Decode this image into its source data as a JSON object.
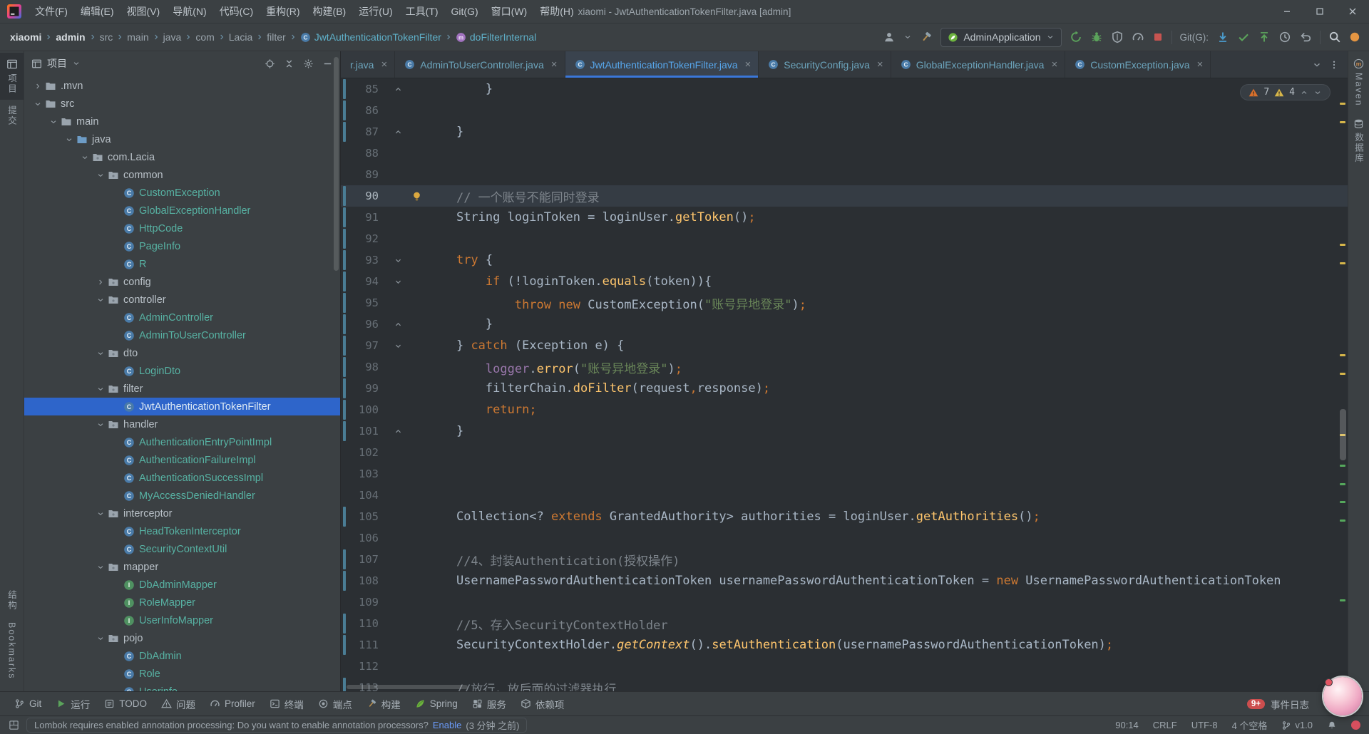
{
  "window": {
    "title": "xiaomi - JwtAuthenticationTokenFilter.java [admin]",
    "menu": [
      "文件(F)",
      "编辑(E)",
      "视图(V)",
      "导航(N)",
      "代码(C)",
      "重构(R)",
      "构建(B)",
      "运行(U)",
      "工具(T)",
      "Git(G)",
      "窗口(W)",
      "帮助(H)"
    ]
  },
  "navbar": {
    "path": [
      "xiaomi",
      "admin",
      "src",
      "main",
      "java",
      "com",
      "Lacia",
      "filter"
    ],
    "class_item": "JwtAuthenticationTokenFilter",
    "method_item": "doFilterInternal",
    "run_config": "AdminApplication",
    "git_label": "Git(G):"
  },
  "left_stripe": {
    "project": "项目",
    "commit": "提交",
    "structure": "结构",
    "bookmarks": "Bookmarks"
  },
  "right_stripe": {
    "maven": "Maven",
    "database": "数据库"
  },
  "project_panel": {
    "title": "项目",
    "tree": [
      {
        "l": ".mvn",
        "t": "folder",
        "c": "r",
        "i": 0
      },
      {
        "l": "src",
        "t": "folder",
        "c": "d",
        "i": 0
      },
      {
        "l": "main",
        "t": "folder",
        "c": "d",
        "i": 1
      },
      {
        "l": "java",
        "t": "src",
        "c": "d",
        "i": 2
      },
      {
        "l": "com.Lacia",
        "t": "pkg",
        "c": "d",
        "i": 3
      },
      {
        "l": "common",
        "t": "pkg",
        "c": "d",
        "i": 4
      },
      {
        "l": "CustomException",
        "t": "class",
        "c": "n",
        "i": 5
      },
      {
        "l": "GlobalExceptionHandler",
        "t": "class",
        "c": "n",
        "i": 5
      },
      {
        "l": "HttpCode",
        "t": "class",
        "c": "n",
        "i": 5
      },
      {
        "l": "PageInfo",
        "t": "class",
        "c": "n",
        "i": 5
      },
      {
        "l": "R",
        "t": "class",
        "c": "n",
        "i": 5
      },
      {
        "l": "config",
        "t": "pkg",
        "c": "r",
        "i": 4
      },
      {
        "l": "controller",
        "t": "pkg",
        "c": "d",
        "i": 4
      },
      {
        "l": "AdminController",
        "t": "class",
        "c": "n",
        "i": 5
      },
      {
        "l": "AdminToUserController",
        "t": "class",
        "c": "n",
        "i": 5
      },
      {
        "l": "dto",
        "t": "pkg",
        "c": "d",
        "i": 4
      },
      {
        "l": "LoginDto",
        "t": "class",
        "c": "n",
        "i": 5
      },
      {
        "l": "filter",
        "t": "pkg",
        "c": "d",
        "i": 4
      },
      {
        "l": "JwtAuthenticationTokenFilter",
        "t": "class",
        "c": "n",
        "i": 5,
        "sel": true
      },
      {
        "l": "handler",
        "t": "pkg",
        "c": "d",
        "i": 4
      },
      {
        "l": "AuthenticationEntryPointImpl",
        "t": "class",
        "c": "n",
        "i": 5
      },
      {
        "l": "AuthenticationFailureImpl",
        "t": "class",
        "c": "n",
        "i": 5
      },
      {
        "l": "AuthenticationSuccessImpl",
        "t": "class",
        "c": "n",
        "i": 5
      },
      {
        "l": "MyAccessDeniedHandler",
        "t": "class",
        "c": "n",
        "i": 5
      },
      {
        "l": "interceptor",
        "t": "pkg",
        "c": "d",
        "i": 4
      },
      {
        "l": "HeadTokenInterceptor",
        "t": "class",
        "c": "n",
        "i": 5
      },
      {
        "l": "SecurityContextUtil",
        "t": "class",
        "c": "n",
        "i": 5
      },
      {
        "l": "mapper",
        "t": "pkg",
        "c": "d",
        "i": 4
      },
      {
        "l": "DbAdminMapper",
        "t": "iface",
        "c": "n",
        "i": 5
      },
      {
        "l": "RoleMapper",
        "t": "iface",
        "c": "n",
        "i": 5
      },
      {
        "l": "UserInfoMapper",
        "t": "iface",
        "c": "n",
        "i": 5
      },
      {
        "l": "pojo",
        "t": "pkg",
        "c": "d",
        "i": 4
      },
      {
        "l": "DbAdmin",
        "t": "class",
        "c": "n",
        "i": 5
      },
      {
        "l": "Role",
        "t": "class",
        "c": "n",
        "i": 5
      },
      {
        "l": "Userinfo",
        "t": "class",
        "c": "n",
        "i": 5
      }
    ]
  },
  "tabs": [
    {
      "label": "r.java",
      "icon": false
    },
    {
      "label": "AdminToUserController.java",
      "icon": true
    },
    {
      "label": "JwtAuthenticationTokenFilter.java",
      "icon": true,
      "active": true
    },
    {
      "label": "SecurityConfig.java",
      "icon": true
    },
    {
      "label": "GlobalExceptionHandler.java",
      "icon": true
    },
    {
      "label": "CustomException.java",
      "icon": true
    }
  ],
  "inspections": {
    "warnings": "7",
    "weak_warnings": "4"
  },
  "editor": {
    "lines": [
      {
        "n": 85,
        "ind": 8,
        "chg": true,
        "fold": "up",
        "tok": [
          [
            "}",
            "d"
          ]
        ]
      },
      {
        "n": 86,
        "ind": 0,
        "chg": true,
        "tok": []
      },
      {
        "n": 87,
        "ind": 4,
        "chg": true,
        "fold": "up",
        "tok": [
          [
            "}",
            "d"
          ]
        ]
      },
      {
        "n": 88,
        "ind": 0,
        "tok": []
      },
      {
        "n": 89,
        "ind": 0,
        "tok": []
      },
      {
        "n": 90,
        "ind": 4,
        "chg": true,
        "cur": true,
        "bulb": true,
        "tok": [
          [
            "// 一个账号不能同时登录",
            "c"
          ]
        ]
      },
      {
        "n": 91,
        "ind": 4,
        "chg": true,
        "tok": [
          [
            "String loginToken = loginUser.",
            "d"
          ],
          [
            "getToken",
            "m"
          ],
          [
            "()",
            "d"
          ],
          [
            ";",
            "k"
          ]
        ]
      },
      {
        "n": 92,
        "ind": 0,
        "chg": true,
        "tok": []
      },
      {
        "n": 93,
        "ind": 4,
        "chg": true,
        "fold": "down",
        "tok": [
          [
            "try",
            "k"
          ],
          [
            " {",
            "d"
          ]
        ]
      },
      {
        "n": 94,
        "ind": 8,
        "chg": true,
        "fold": "down",
        "tok": [
          [
            "if",
            "k"
          ],
          [
            " (!loginToken.",
            "d"
          ],
          [
            "equals",
            "m"
          ],
          [
            "(token)){",
            "d"
          ]
        ]
      },
      {
        "n": 95,
        "ind": 12,
        "chg": true,
        "tok": [
          [
            "throw",
            "k"
          ],
          [
            " ",
            "d"
          ],
          [
            "new",
            "k"
          ],
          [
            " CustomException(",
            "d"
          ],
          [
            "\"账号异地登录\"",
            "s"
          ],
          [
            ")",
            "d"
          ],
          [
            ";",
            "k"
          ]
        ]
      },
      {
        "n": 96,
        "ind": 8,
        "chg": true,
        "fold": "up",
        "tok": [
          [
            "}",
            "d"
          ]
        ]
      },
      {
        "n": 97,
        "ind": 4,
        "chg": true,
        "fold": "down",
        "tok": [
          [
            "} ",
            "d"
          ],
          [
            "catch",
            "k"
          ],
          [
            " (Exception e) {",
            "d"
          ]
        ]
      },
      {
        "n": 98,
        "ind": 8,
        "chg": true,
        "tok": [
          [
            "logger",
            "f"
          ],
          [
            ".",
            "d"
          ],
          [
            "error",
            "m"
          ],
          [
            "(",
            "d"
          ],
          [
            "\"账号异地登录\"",
            "s"
          ],
          [
            ")",
            "d"
          ],
          [
            ";",
            "k"
          ]
        ]
      },
      {
        "n": 99,
        "ind": 8,
        "chg": true,
        "tok": [
          [
            "filterChain.",
            "d"
          ],
          [
            "doFilter",
            "m"
          ],
          [
            "(request",
            "d"
          ],
          [
            ",",
            "k"
          ],
          [
            "response)",
            "d"
          ],
          [
            ";",
            "k"
          ]
        ]
      },
      {
        "n": 100,
        "ind": 8,
        "chg": true,
        "tok": [
          [
            "return",
            "k"
          ],
          [
            ";",
            "k"
          ]
        ]
      },
      {
        "n": 101,
        "ind": 4,
        "chg": true,
        "fold": "up",
        "tok": [
          [
            "}",
            "d"
          ]
        ]
      },
      {
        "n": 102,
        "ind": 0,
        "tok": []
      },
      {
        "n": 103,
        "ind": 0,
        "tok": []
      },
      {
        "n": 104,
        "ind": 0,
        "tok": []
      },
      {
        "n": 105,
        "ind": 4,
        "chg": true,
        "tok": [
          [
            "Collection<? ",
            "d"
          ],
          [
            "extends",
            "k"
          ],
          [
            " GrantedAuthority> authorities = loginUser.",
            "d"
          ],
          [
            "getAuthorities",
            "m"
          ],
          [
            "()",
            "d"
          ],
          [
            ";",
            "k"
          ]
        ]
      },
      {
        "n": 106,
        "ind": 0,
        "tok": []
      },
      {
        "n": 107,
        "ind": 4,
        "chg": true,
        "tok": [
          [
            "//4、封装Authentication(授权操作)",
            "c"
          ]
        ]
      },
      {
        "n": 108,
        "ind": 4,
        "chg": true,
        "tok": [
          [
            "UsernamePasswordAuthenticationToken usernamePasswordAuthenticationToken = ",
            "d"
          ],
          [
            "new",
            "k"
          ],
          [
            " UsernamePasswordAuthenticationToken",
            "d"
          ]
        ]
      },
      {
        "n": 109,
        "ind": 0,
        "tok": []
      },
      {
        "n": 110,
        "ind": 4,
        "chg": true,
        "tok": [
          [
            "//5、存入SecurityContextHolder",
            "c"
          ]
        ]
      },
      {
        "n": 111,
        "ind": 4,
        "chg": true,
        "tok": [
          [
            "SecurityContextHolder.",
            "d"
          ],
          [
            "getContext",
            "mi"
          ],
          [
            "().",
            "d"
          ],
          [
            "setAuthentication",
            "m"
          ],
          [
            "(usernamePasswordAuthenticationToken)",
            "d"
          ],
          [
            ";",
            "k"
          ]
        ]
      },
      {
        "n": 112,
        "ind": 0,
        "tok": []
      },
      {
        "n": 113,
        "ind": 4,
        "chg": true,
        "tok": [
          [
            "//放行，放后面的过滤器执行",
            "c"
          ]
        ]
      }
    ]
  },
  "bottom_bar": {
    "items": [
      {
        "label": "Git",
        "icon": "branch"
      },
      {
        "label": "运行",
        "icon": "play"
      },
      {
        "label": "TODO",
        "icon": "todo"
      },
      {
        "label": "问题",
        "icon": "problems"
      },
      {
        "label": "Profiler",
        "icon": "gauge"
      },
      {
        "label": "终端",
        "icon": "terminal"
      },
      {
        "label": "端点",
        "icon": "endpoints"
      },
      {
        "label": "构建",
        "icon": "hammer"
      },
      {
        "label": "Spring",
        "icon": "leaf"
      },
      {
        "label": "服务",
        "icon": "services"
      },
      {
        "label": "依赖项",
        "icon": "deps"
      }
    ],
    "events_count": "9+",
    "events_label": "事件日志"
  },
  "status_bar": {
    "message": "Lombok requires enabled annotation processing: Do you want to enable annotation processors?",
    "action": "Enable",
    "ago": "(3 分钟 之前)",
    "caret": "90:14",
    "line_ending": "CRLF",
    "encoding": "UTF-8",
    "indent": "4 个空格",
    "version": "v1.0"
  }
}
